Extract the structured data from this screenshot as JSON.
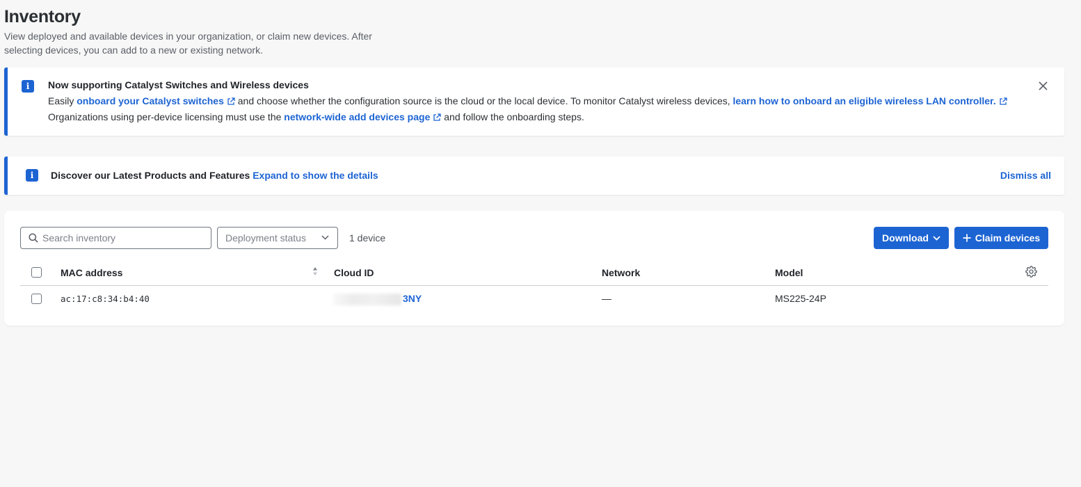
{
  "page": {
    "title": "Inventory",
    "description": "View deployed and available devices in your organization, or claim new devices. After selecting devices, you can add to a new or existing network."
  },
  "catalyst_banner": {
    "icon": "info-icon",
    "title": "Now supporting Catalyst Switches and Wireless devices",
    "line1_prefix": "Easily",
    "link_onboard": "onboard your Catalyst switches",
    "line1_middle": "and choose whether the configuration source is the cloud or the local device. To monitor Catalyst wireless devices,",
    "link_learn": "learn how to onboard an eligible wireless LAN controller.",
    "line2_prefix": "Organizations using per-device licensing must use the",
    "link_network_wide": "network-wide add devices page",
    "line2_suffix": "and follow the onboarding steps."
  },
  "discover_banner": {
    "icon": "info-icon",
    "title": "Discover our Latest Products and Features",
    "expand_link": "Expand to show the details",
    "dismiss_all": "Dismiss all"
  },
  "toolbar": {
    "search_placeholder": "Search inventory",
    "deployment_status_placeholder": "Deployment status",
    "device_count": "1 device",
    "download_label": "Download",
    "claim_label": "Claim devices"
  },
  "table": {
    "columns": [
      "MAC address",
      "Cloud ID",
      "Network",
      "Model"
    ],
    "rows": [
      {
        "mac": "ac:17:c8:34:b4:40",
        "cloud_id_visible": "3NY",
        "network": "—",
        "model": "MS225-24P"
      }
    ]
  },
  "colors": {
    "accent": "#1d64d3",
    "background": "#f7f7f7"
  }
}
